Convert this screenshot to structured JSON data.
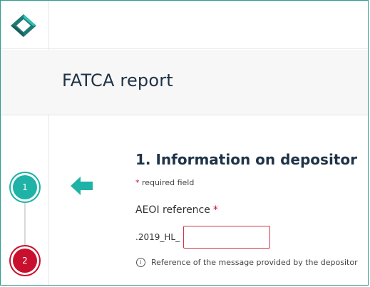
{
  "header": {
    "title": "FATCA report"
  },
  "steps": [
    {
      "number": "1",
      "color": "#1fb2a6"
    },
    {
      "number": "2",
      "color": "#c8102e"
    }
  ],
  "section": {
    "title": "1. Information on depositor",
    "required_star": "*",
    "required_text": "required field"
  },
  "field": {
    "label": "AEOI reference",
    "required_star": "*",
    "prefix": ".2019_HL_",
    "value": "",
    "help_text": "Reference of the message provided by the depositor"
  },
  "icons": {
    "logo": "diamond-logo-icon",
    "arrow": "arrow-left-icon",
    "info": "info-icon"
  },
  "colors": {
    "accent": "#1fb2a6",
    "error": "#c8102e",
    "title": "#1f3346"
  }
}
